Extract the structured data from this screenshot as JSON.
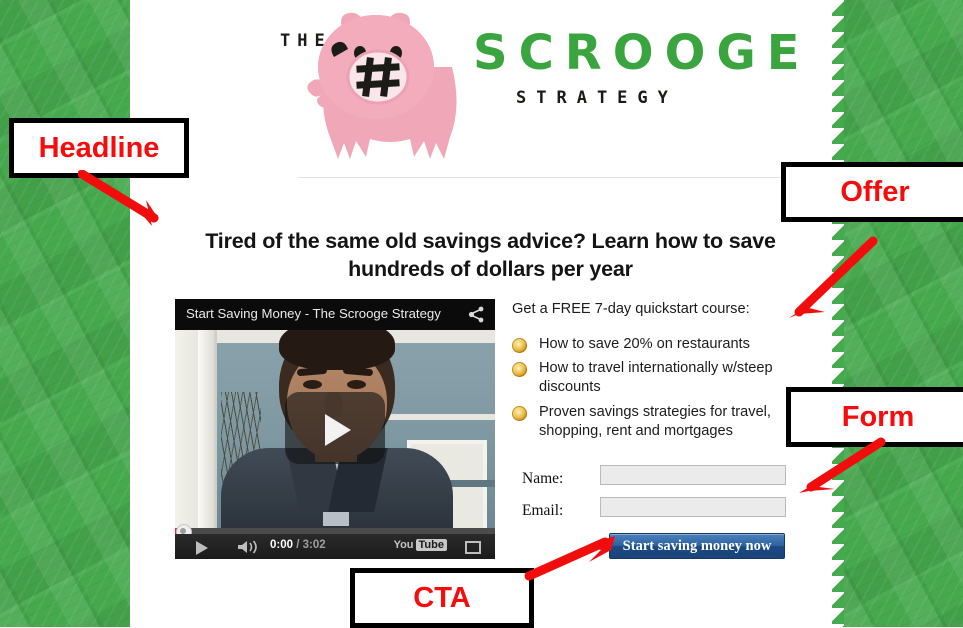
{
  "logo": {
    "the": "THE",
    "brand": "SCROOGE",
    "tagline": "STRATEGY",
    "pig_icon": "pig-icon",
    "brand_color": "#3aa43f"
  },
  "headline": "Tired of the same old savings advice? Learn how to save hundreds of dollars per year",
  "video": {
    "title": "Start Saving Money - The Scrooge Strategy",
    "share_icon": "share-icon",
    "play_icon": "play-icon",
    "volume_icon": "volume-icon",
    "current_time": "0:00",
    "separator": " / ",
    "duration": "3:02",
    "brand_you": "You",
    "brand_tube": "Tube",
    "fullscreen_icon": "fullscreen-icon"
  },
  "offer": {
    "lead": "Get a FREE 7-day quickstart course:",
    "bullets": [
      "How to save 20% on restaurants",
      "How to travel internationally w/steep discounts",
      "Proven savings strategies for travel, shopping, rent and mortgages"
    ]
  },
  "form": {
    "name_label": "Name:",
    "name_value": "",
    "email_label": "Email:",
    "email_value": "",
    "cta_label": "Start saving money now"
  },
  "annotations": [
    {
      "label": "Headline",
      "arrow": "arrow-down-right"
    },
    {
      "label": "Offer",
      "arrow": "arrow-down-left"
    },
    {
      "label": "Form",
      "arrow": "arrow-down-left"
    },
    {
      "label": "CTA",
      "arrow": "arrow-up-right"
    }
  ],
  "colors": {
    "annotation_text": "#f60c0c",
    "annotation_border": "#000000",
    "background_green": "#46a94d",
    "cta_blue": "#1b4a83"
  }
}
